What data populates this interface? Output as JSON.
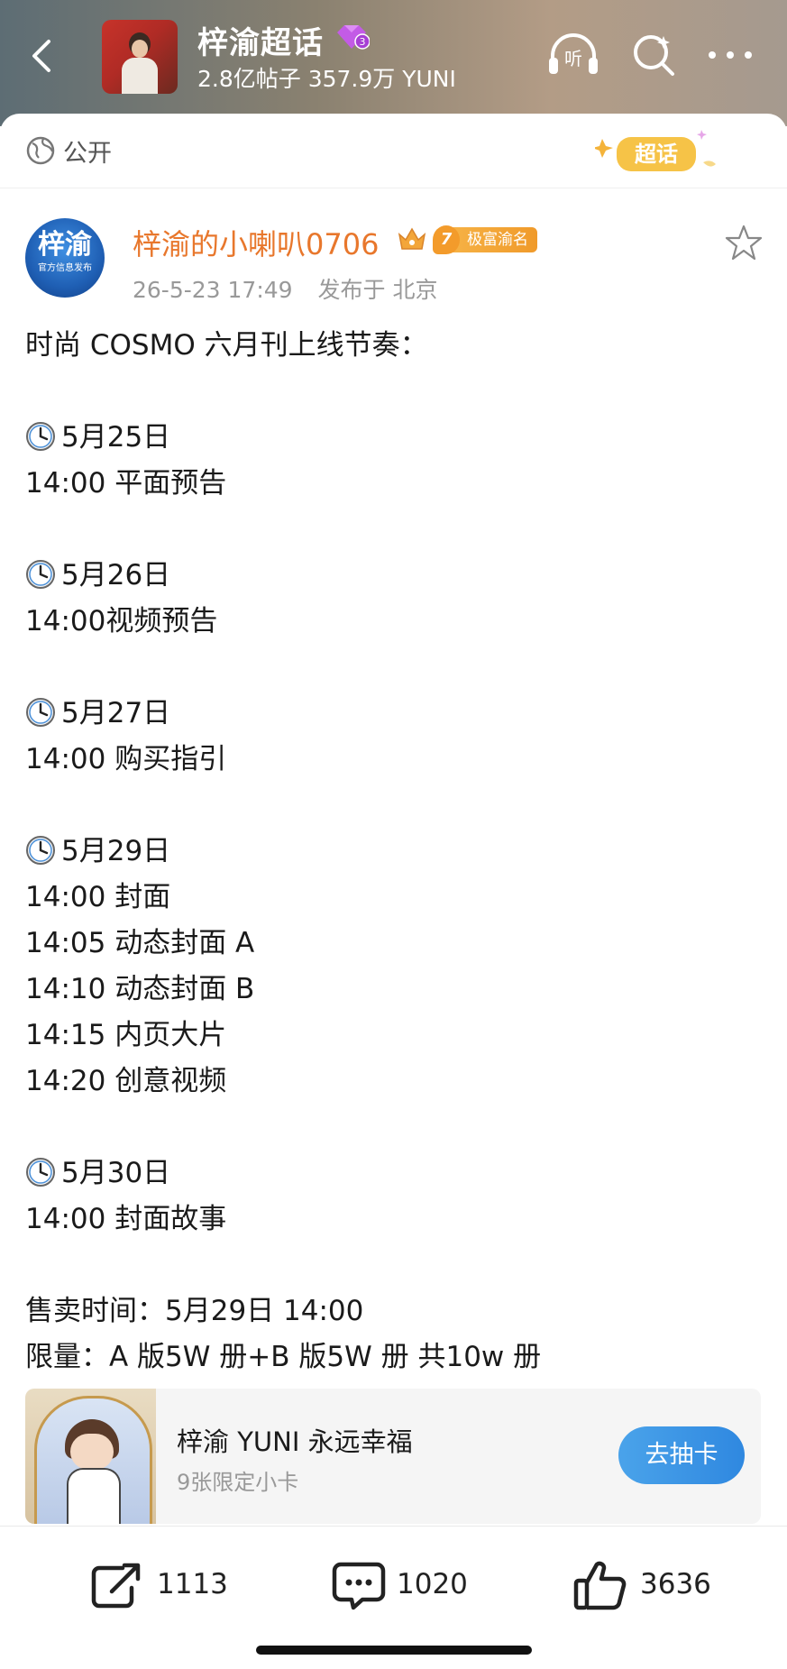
{
  "header": {
    "title": "梓渝超话",
    "stats": "2.8亿帖子 357.9万 YUNI",
    "level_badge": "3",
    "listen_label": "听"
  },
  "visibility": {
    "label": "公开",
    "logo_text": "超话"
  },
  "post": {
    "author": {
      "name": "梓渝的小喇叭0706",
      "avatar_line1": "梓渝",
      "avatar_line2": "官方信息发布",
      "fan_level": "7",
      "fan_badge": "极富渝名"
    },
    "time": "26-5-23 17:49",
    "location": "发布于 北京",
    "lines": [
      {
        "text": "时尚 COSMO 六月刊上线节奏："
      },
      {
        "text": ""
      },
      {
        "text": "5月25日",
        "clock": true
      },
      {
        "text": "14:00 平面预告"
      },
      {
        "text": ""
      },
      {
        "text": "5月26日",
        "clock": true
      },
      {
        "text": "14:00视频预告"
      },
      {
        "text": ""
      },
      {
        "text": "5月27日",
        "clock": true
      },
      {
        "text": "14:00 购买指引"
      },
      {
        "text": ""
      },
      {
        "text": "5月29日",
        "clock": true
      },
      {
        "text": "14:00 封面"
      },
      {
        "text": "14:05 动态封面 A"
      },
      {
        "text": "14:10 动态封面 B"
      },
      {
        "text": "14:15 内页大片"
      },
      {
        "text": "14:20 创意视频"
      },
      {
        "text": ""
      },
      {
        "text": "5月30日",
        "clock": true
      },
      {
        "text": "14:00 封面故事"
      },
      {
        "text": ""
      },
      {
        "text": "售卖时间：5月29日 14:00"
      },
      {
        "text": "限量：A 版5W 册+B 版5W 册 共10w 册"
      }
    ]
  },
  "card": {
    "title": "梓渝 YUNI 永远幸福",
    "subtitle": "9张限定小卡",
    "button": "去抽卡"
  },
  "actions": {
    "share": "1113",
    "comment": "1020",
    "like": "3636"
  },
  "colors": {
    "author_name": "#e8772c",
    "button": "#3a95e6"
  },
  "icons": [
    "back-icon",
    "listen-icon",
    "search-icon",
    "more-icon",
    "globe-icon",
    "star-icon",
    "clock-icon",
    "share-icon",
    "comment-icon",
    "like-icon"
  ]
}
